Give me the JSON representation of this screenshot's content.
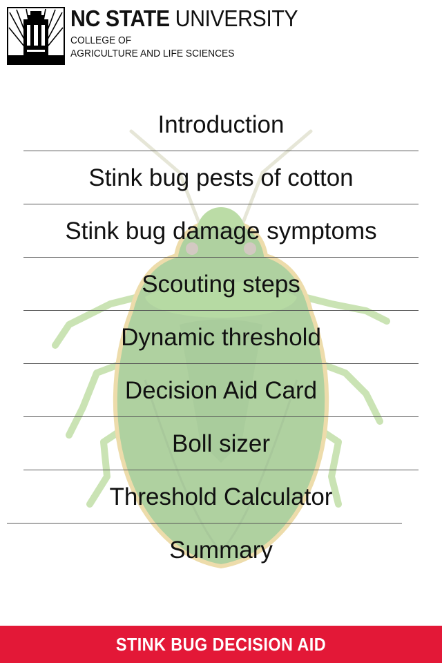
{
  "header": {
    "university_bold": "NC STATE",
    "university_light": "UNIVERSITY",
    "college_line_1": "COLLEGE OF",
    "college_line_2": "AGRICULTURE AND LIFE SCIENCES",
    "logo_icon": "belltower-icon"
  },
  "background": {
    "image_icon": "stink-bug-icon",
    "colors": {
      "bug_body": "#4f9a2e",
      "bug_legs": "#8cc25a",
      "bug_edge": "#d9b347"
    }
  },
  "menu": {
    "items": [
      {
        "label": "Introduction"
      },
      {
        "label": "Stink bug pests of cotton"
      },
      {
        "label": "Stink bug damage symptoms"
      },
      {
        "label": "Scouting steps"
      },
      {
        "label": "Dynamic threshold"
      },
      {
        "label": "Decision Aid Card"
      },
      {
        "label": "Boll sizer"
      },
      {
        "label": "Threshold Calculator"
      },
      {
        "label": "Summary"
      }
    ]
  },
  "footer": {
    "label": "STINK BUG DECISION AID",
    "color": "#e31837"
  }
}
